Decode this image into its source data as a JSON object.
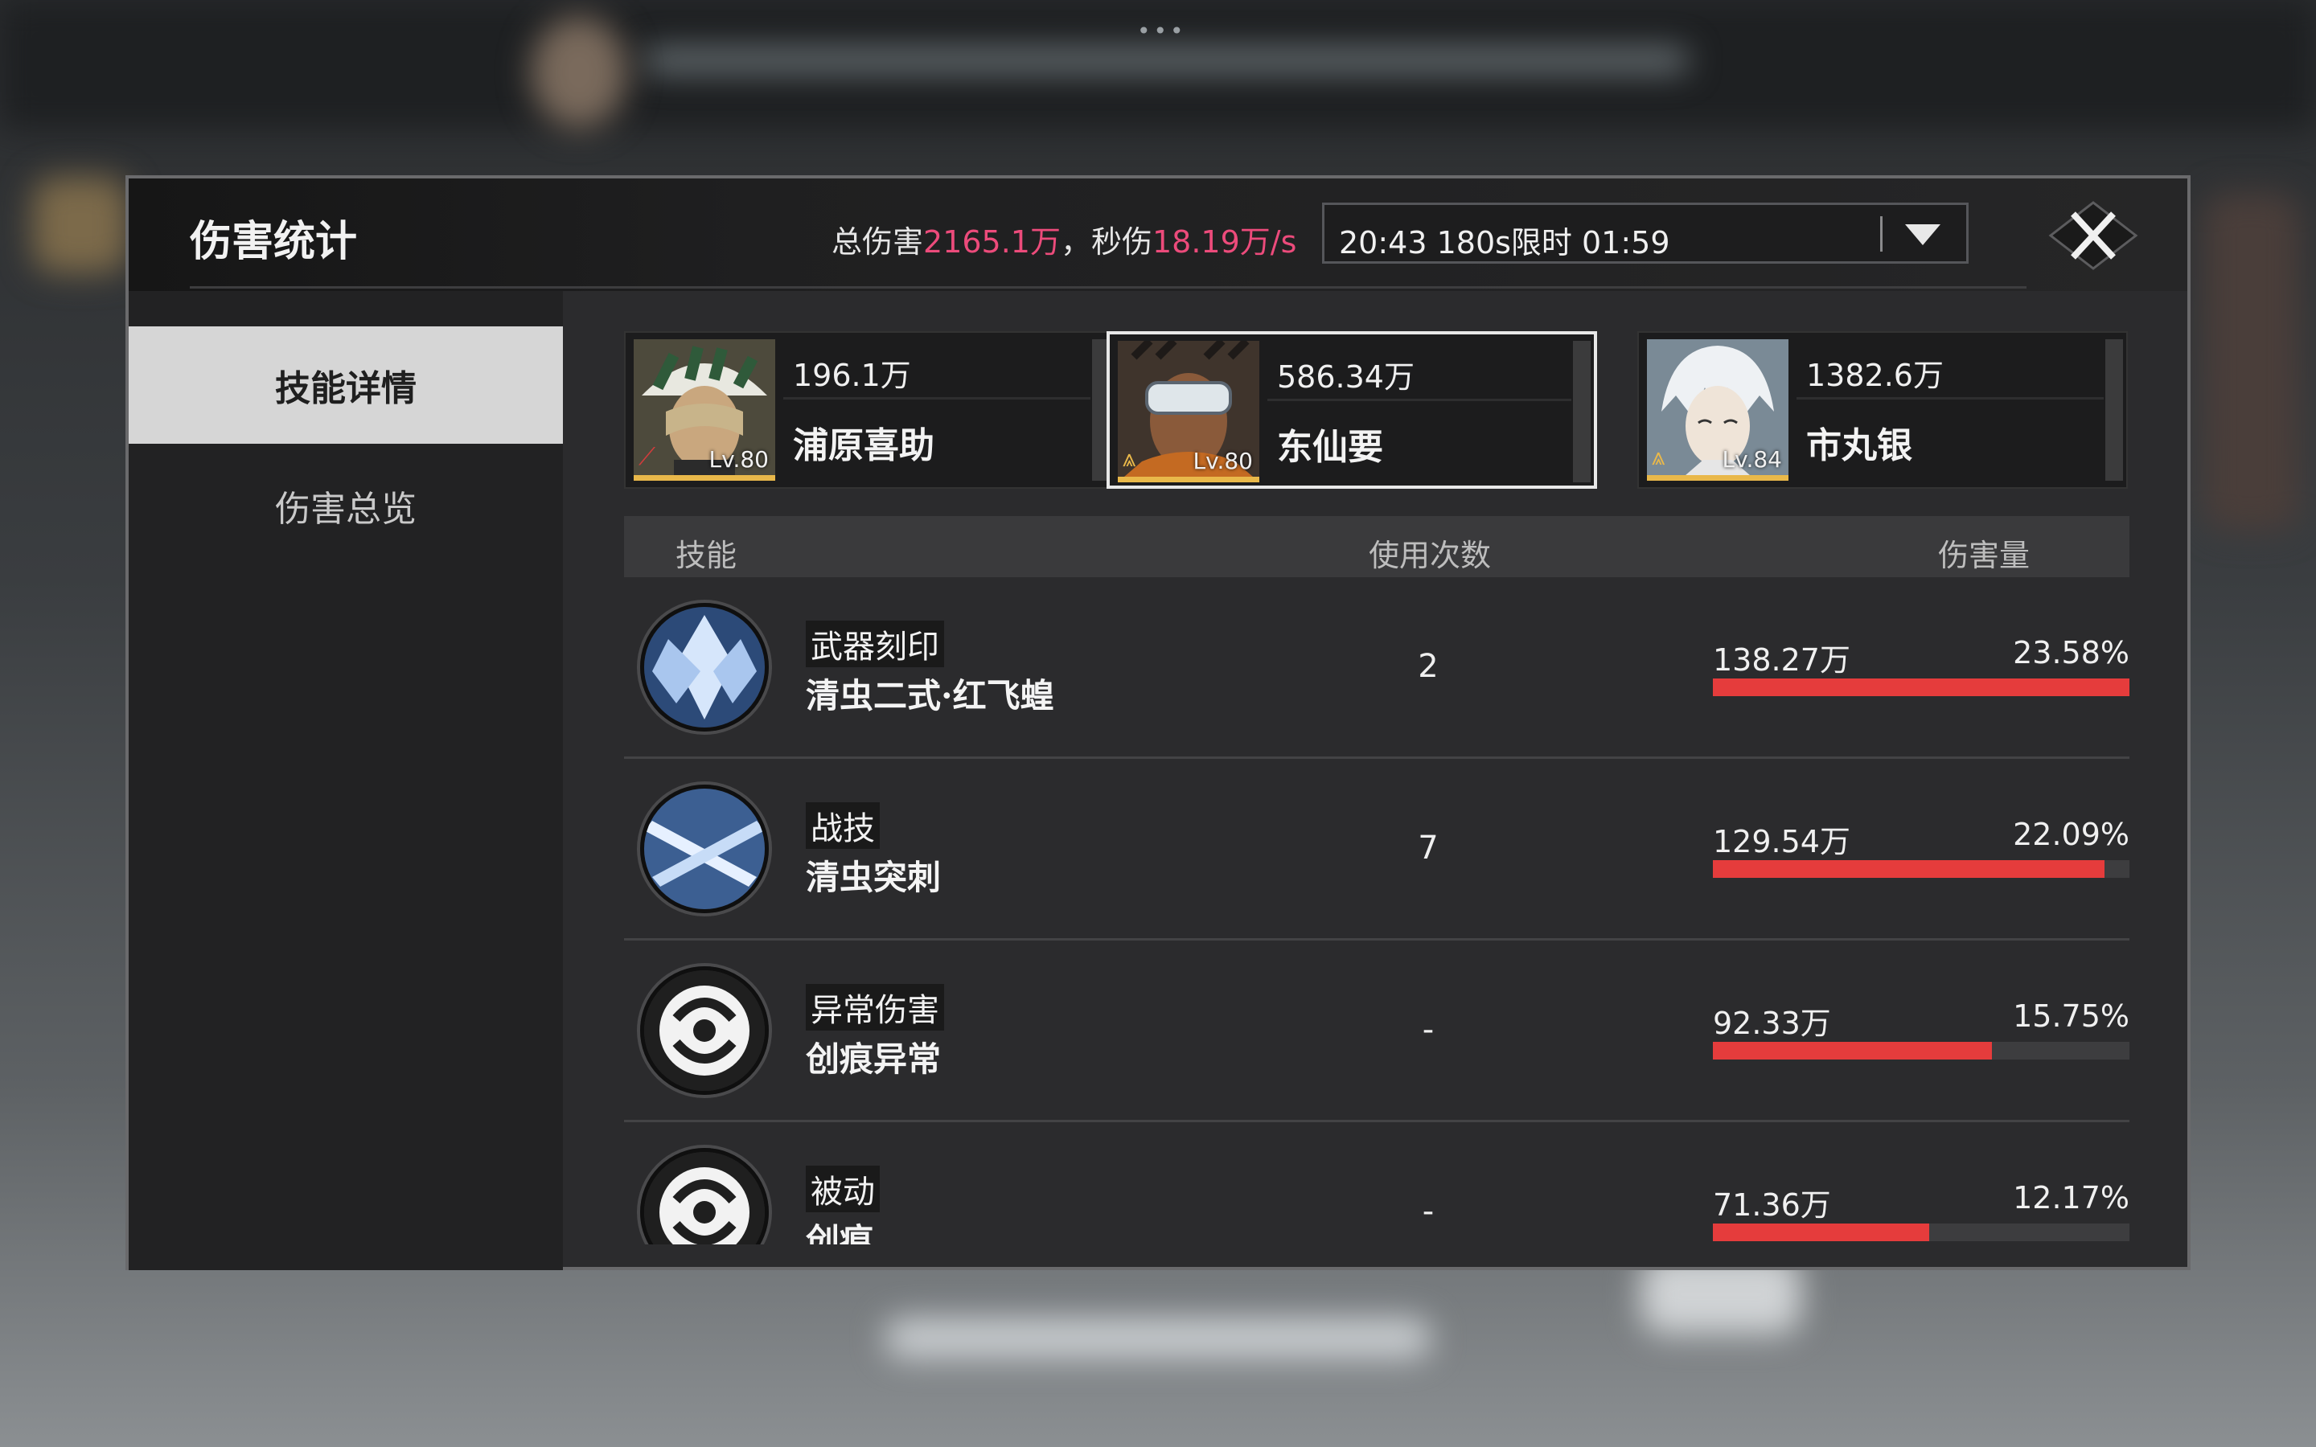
{
  "window": {
    "title": "伤害统计",
    "summary": {
      "total_label": "总伤害",
      "total_value": "2165.1万",
      "dps_label": "，秒伤",
      "dps_value": "18.19万/s"
    },
    "time_select": {
      "value": "20:43 180s限时 01:59"
    },
    "close": "close-icon"
  },
  "sidebar": {
    "items": [
      {
        "label": "技能详情",
        "active": true
      },
      {
        "label": "伤害总览",
        "active": false
      }
    ]
  },
  "characters": [
    {
      "damage": "196.1万",
      "name": "浦原喜助",
      "level": "Lv.80",
      "selected": false
    },
    {
      "damage": "586.34万",
      "name": "东仙要",
      "level": "Lv.80",
      "selected": true
    },
    {
      "damage": "1382.6万",
      "name": "市丸银",
      "level": "Lv.84",
      "selected": false
    }
  ],
  "table": {
    "headers": {
      "skill": "技能",
      "usage": "使用次数",
      "damage": "伤害量"
    },
    "rows": [
      {
        "type": "武器刻印",
        "name": "清虫二式·红飞蝗",
        "usage": "2",
        "damage": "138.27万",
        "percent": "23.58%",
        "fill": 1.0
      },
      {
        "type": "战技",
        "name": "清虫突刺",
        "usage": "7",
        "damage": "129.54万",
        "percent": "22.09%",
        "fill": 0.94
      },
      {
        "type": "异常伤害",
        "name": "创痕异常",
        "usage": "-",
        "damage": "92.33万",
        "percent": "15.75%",
        "fill": 0.67
      },
      {
        "type": "被动",
        "name": "创痕",
        "usage": "-",
        "damage": "71.36万",
        "percent": "12.17%",
        "fill": 0.52
      }
    ]
  },
  "colors": {
    "accent_pink": "#ec4b7b",
    "bar_red": "#e53c3c",
    "level_gold": "#e9b84a"
  }
}
